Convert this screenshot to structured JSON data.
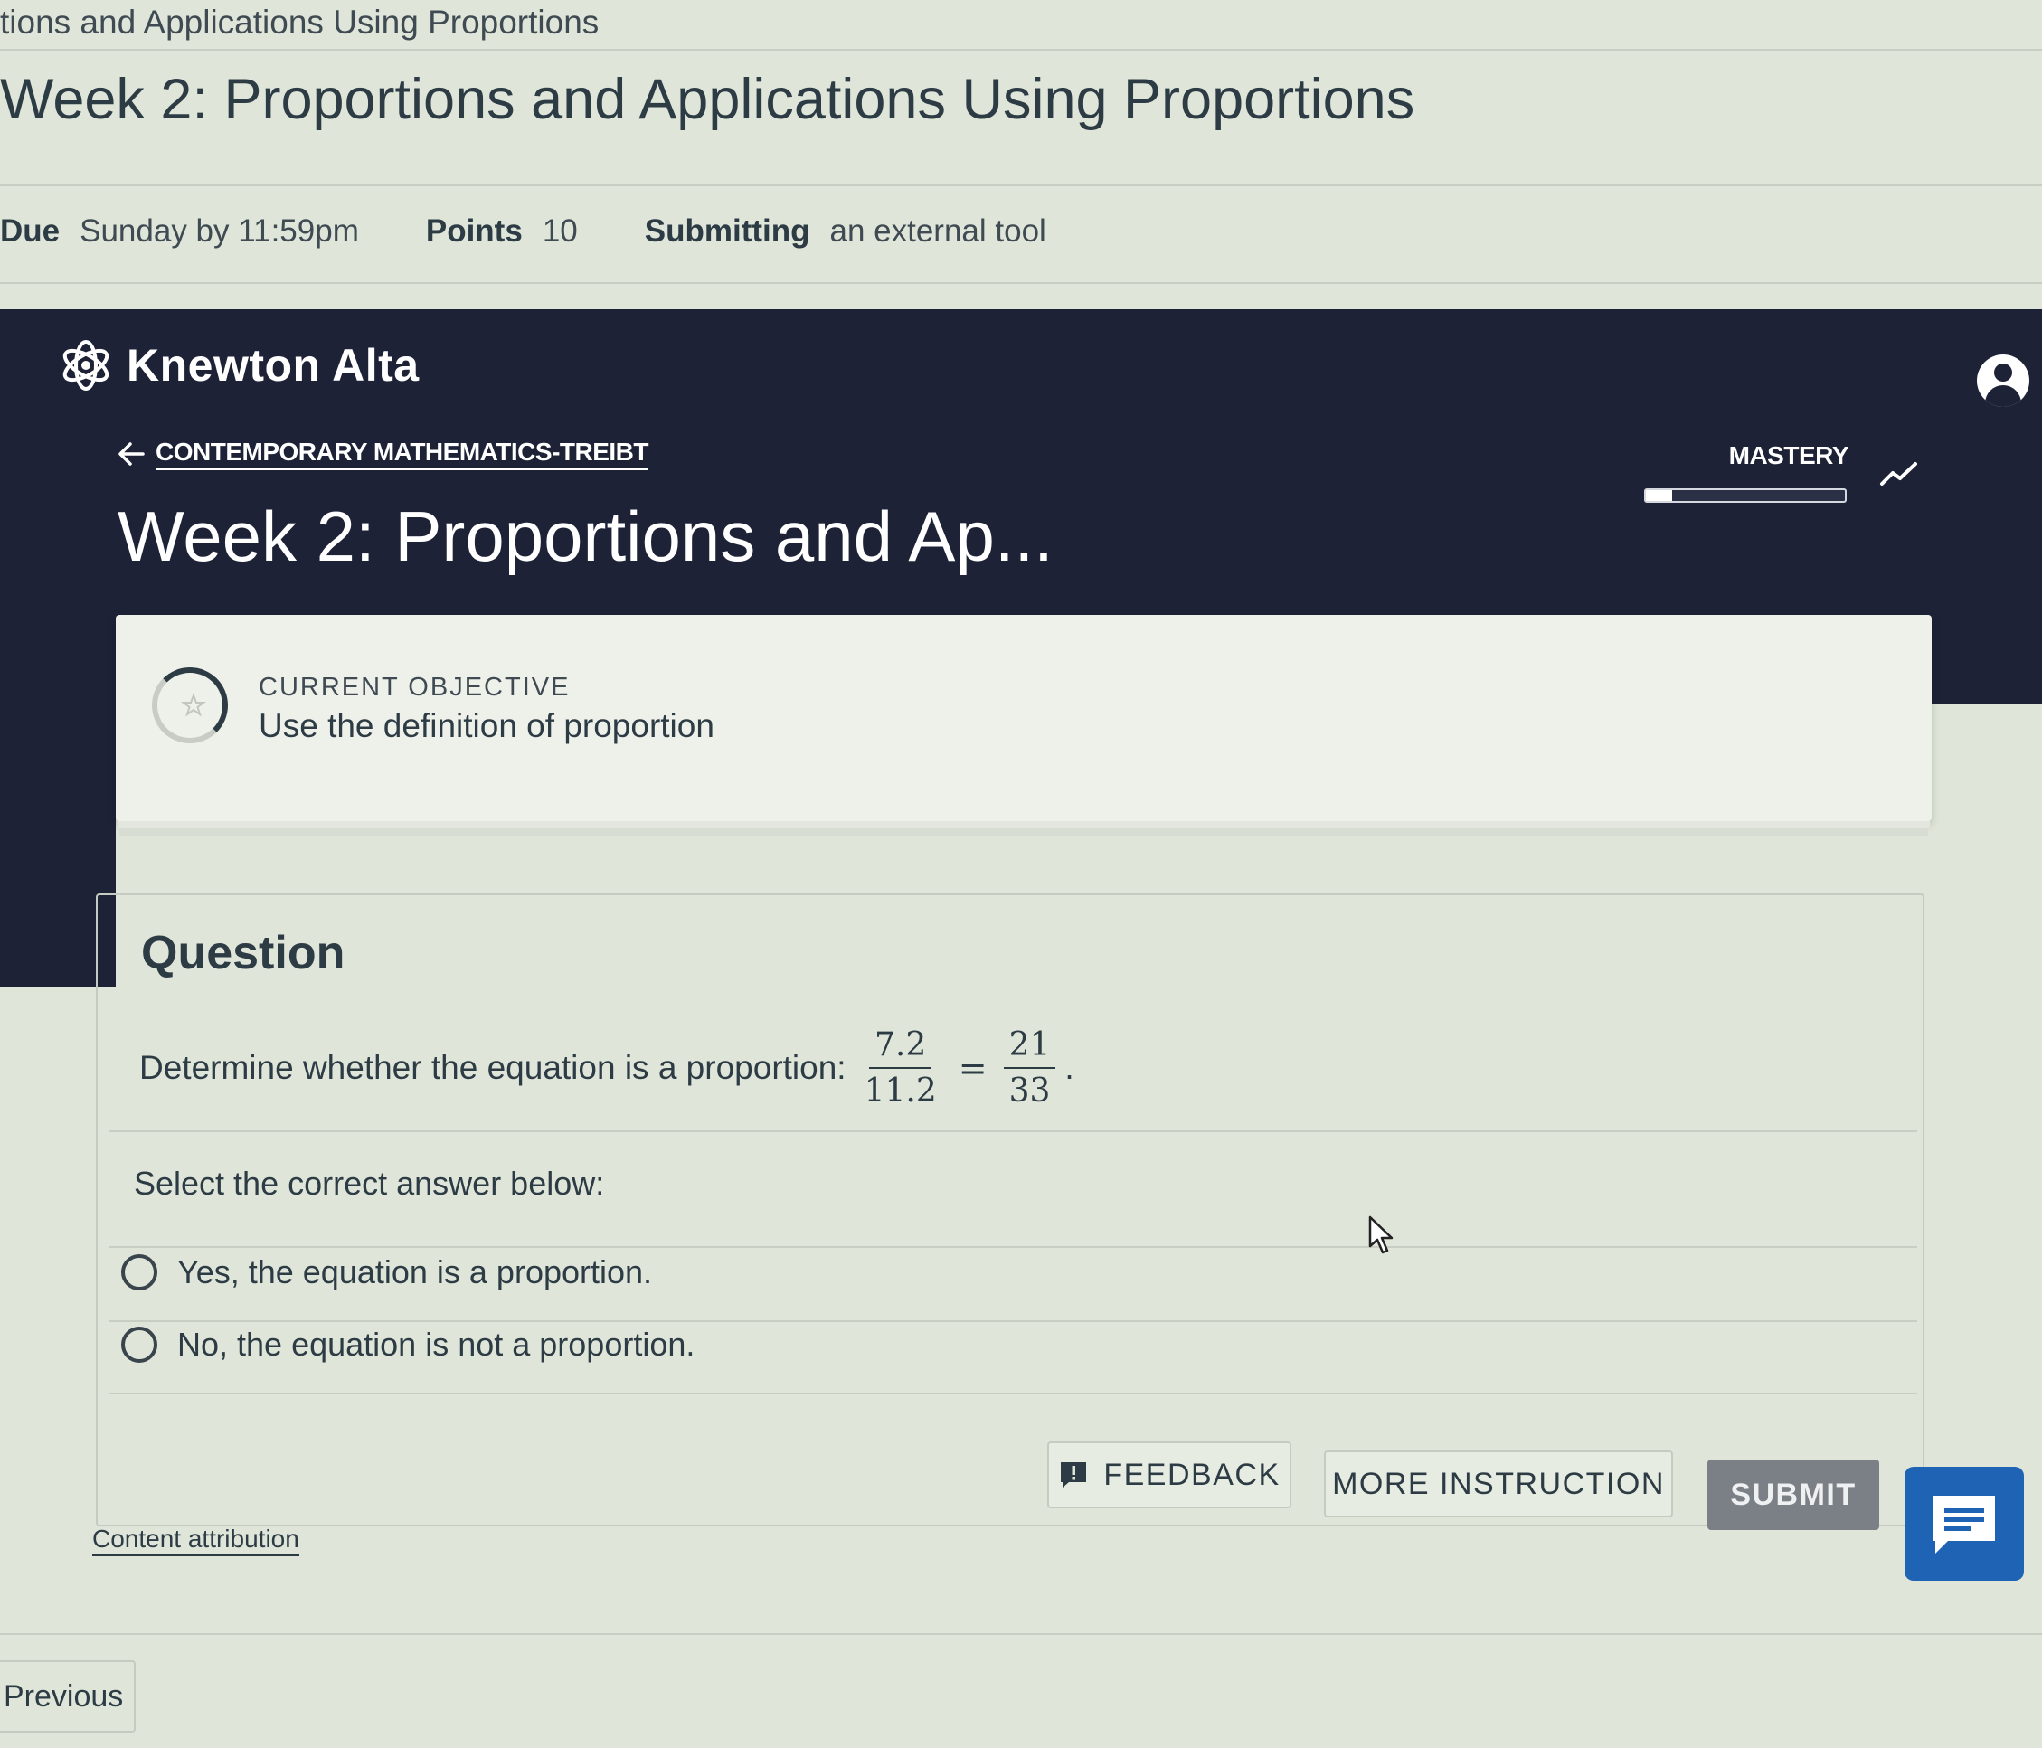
{
  "lms": {
    "breadcrumb": "tions and Applications Using Proportions",
    "page_title": "Week 2: Proportions and Applications Using Proportions",
    "due_label": "Due",
    "due_value": "Sunday by 11:59pm",
    "points_label": "Points",
    "points_value": "10",
    "submitting_label": "Submitting",
    "submitting_value": "an external tool"
  },
  "alta": {
    "brand": "Knewton Alta",
    "course_link": "CONTEMPORARY MATHEMATICS-TREIBT",
    "assignment_title": "Week 2: Proportions and Ap...",
    "mastery_label": "MASTERY",
    "mastery_progress": 0.13
  },
  "objective": {
    "eyebrow": "CURRENT OBJECTIVE",
    "text": "Use the definition of proportion"
  },
  "question": {
    "heading": "Question",
    "text": "Determine whether the equation is a proportion:",
    "fraction_left": {
      "numerator": "7.2",
      "denominator": "11.2"
    },
    "equals": "=",
    "fraction_right": {
      "numerator": "21",
      "denominator": "33"
    },
    "trailing": ".",
    "prompt": "Select the correct answer below:",
    "choices": [
      {
        "label": "Yes, the equation is a proportion.",
        "selected": false
      },
      {
        "label": "No, the equation is not a proportion.",
        "selected": false
      }
    ]
  },
  "actions": {
    "feedback": "FEEDBACK",
    "more_instruction": "MORE INSTRUCTION",
    "submit": "SUBMIT",
    "content_attribution": "Content attribution",
    "previous": "Previous"
  },
  "icons": {
    "brand": "atom-logo-icon",
    "account": "user-avatar-icon",
    "back": "arrow-left-icon",
    "trend": "trend-up-icon",
    "objective": "star-progress-icon",
    "feedback": "feedback-alert-icon",
    "chat": "chat-icon"
  },
  "colors": {
    "band": "#1d2237",
    "chat_button": "#1f63b5",
    "submit_disabled": "#7b8086"
  }
}
